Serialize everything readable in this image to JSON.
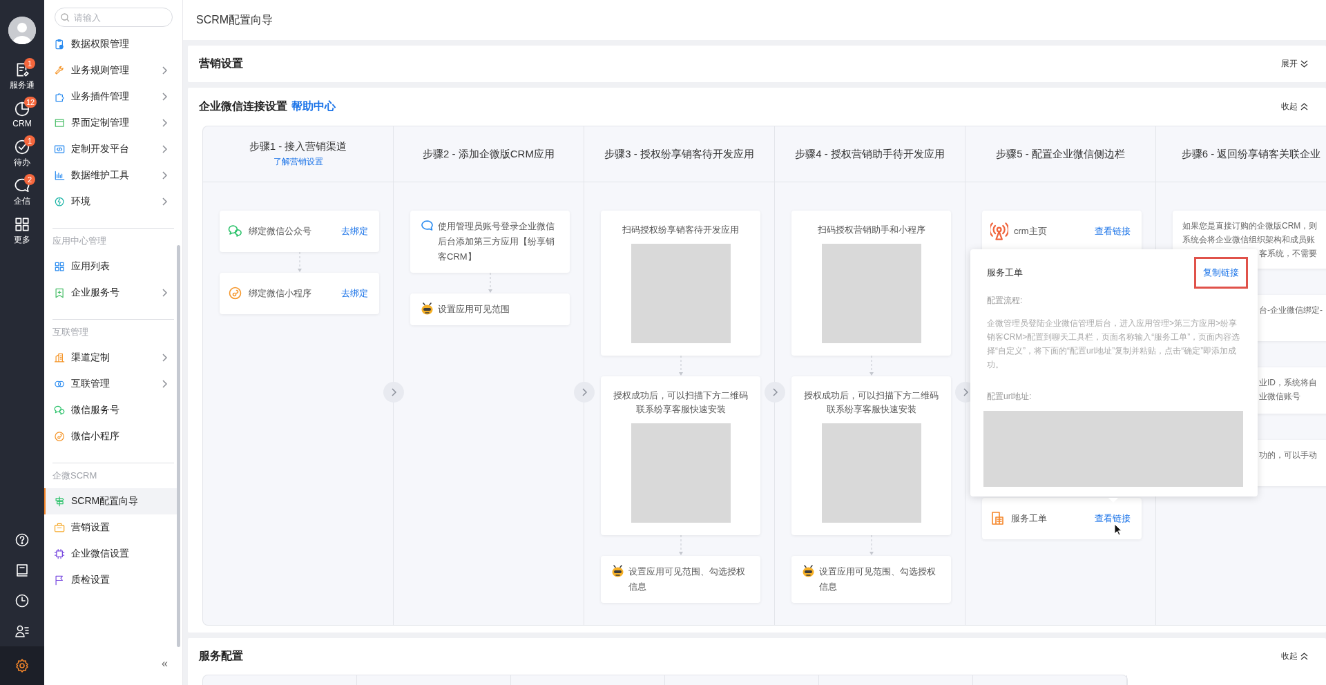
{
  "rail": {
    "items": [
      {
        "label": "服务通",
        "kind": "service",
        "badge": "1"
      },
      {
        "label": "CRM",
        "kind": "crm",
        "badge": "12"
      },
      {
        "label": "待办",
        "kind": "todo",
        "badge": "1"
      },
      {
        "label": "企信",
        "kind": "chat",
        "badge": "2"
      },
      {
        "label": "更多",
        "kind": "more"
      }
    ],
    "bottom_icons": [
      {
        "kind": "help",
        "selected": false
      },
      {
        "kind": "book",
        "selected": false
      },
      {
        "kind": "clock",
        "selected": false
      },
      {
        "kind": "contacts",
        "selected": false
      },
      {
        "kind": "settings",
        "selected": true
      }
    ]
  },
  "sidebar": {
    "search": {
      "placeholder": "请输入"
    },
    "groups": [
      {
        "items": [
          {
            "label": "数据权限管理",
            "kind": "clipboard",
            "has_submenu": false,
            "selected": false
          },
          {
            "label": "业务规则管理",
            "kind": "wrench",
            "has_submenu": true,
            "selected": false
          },
          {
            "label": "业务插件管理",
            "kind": "puzzle",
            "has_submenu": true,
            "selected": false
          },
          {
            "label": "界面定制管理",
            "kind": "window",
            "has_submenu": true,
            "selected": false
          },
          {
            "label": "定制开发平台",
            "kind": "code",
            "has_submenu": true,
            "selected": false
          },
          {
            "label": "数据维护工具",
            "kind": "barchart",
            "has_submenu": true,
            "selected": false
          },
          {
            "label": "环境",
            "kind": "bolt",
            "has_submenu": true,
            "selected": false
          }
        ]
      },
      {
        "title": "应用中心管理",
        "items": [
          {
            "label": "应用列表",
            "kind": "grid",
            "has_submenu": false,
            "selected": false
          },
          {
            "label": "企业服务号",
            "kind": "bookmark",
            "has_submenu": true,
            "selected": false
          }
        ]
      },
      {
        "title": "互联管理",
        "items": [
          {
            "label": "渠道定制",
            "kind": "building",
            "has_submenu": true,
            "selected": false
          },
          {
            "label": "互联管理",
            "kind": "rings",
            "has_submenu": true,
            "selected": false
          },
          {
            "label": "微信服务号",
            "kind": "wechat",
            "has_submenu": false,
            "selected": false
          },
          {
            "label": "微信小程序",
            "kind": "miniapp",
            "has_submenu": false,
            "selected": false
          }
        ]
      },
      {
        "title": "企微SCRM",
        "items": [
          {
            "label": "SCRM配置向导",
            "kind": "signpost",
            "has_submenu": false,
            "selected": true
          },
          {
            "label": "营销设置",
            "kind": "briefcase",
            "has_submenu": false,
            "selected": false
          },
          {
            "label": "企业微信设置",
            "kind": "chip",
            "has_submenu": false,
            "selected": false
          },
          {
            "label": "质检设置",
            "kind": "flag",
            "has_submenu": false,
            "selected": false
          }
        ]
      }
    ],
    "collapse": "«"
  },
  "page_title": "SCRM配置向导",
  "sections": [
    {
      "title": "营销设置",
      "toggle": "展开",
      "expanded": false
    },
    {
      "title": "企业微信连接设置",
      "link": "帮助中心",
      "toggle": "收起",
      "expanded": true,
      "steps": [
        {
          "title": "步骤1 - 接入营销渠道",
          "link": "了解营销设置",
          "connected": true,
          "cards": [
            {
              "kind": "wechat",
              "text": "绑定微信公众号",
              "action": "去绑定"
            },
            {
              "kind": "miniapp",
              "text": "绑定微信小程序",
              "action": "去绑定"
            }
          ]
        },
        {
          "title": "步骤2 - 添加企微版CRM应用",
          "connected": true,
          "cards": [
            {
              "kind": "bubble",
              "text": "使用管理员账号登录企业微信后台添加第三方应用【纷享销客CRM】"
            },
            {
              "kind": "mascot",
              "text": "设置应用可见范围"
            }
          ]
        },
        {
          "title": "步骤3 - 授权纷享销客待开发应用",
          "connected": true,
          "cards": [
            {
              "kind": "qr",
              "text": "扫码授权纷享销客待开发应用"
            },
            {
              "kind": "qr",
              "text": "授权成功后，可以扫描下方二维码联系纷享客服快速安装"
            },
            {
              "kind": "mascot",
              "text": "设置应用可见范围、勾选授权信息"
            }
          ]
        },
        {
          "title": "步骤4 - 授权营销助手待开发应用",
          "connected": true,
          "cards": [
            {
              "kind": "qr",
              "text": "扫码授权营销助手和小程序"
            },
            {
              "kind": "qr",
              "text": "授权成功后，可以扫描下方二维码联系纷享客服快速安装"
            },
            {
              "kind": "mascot",
              "text": "设置应用可见范围、勾选授权信息"
            }
          ]
        },
        {
          "title": "步骤5 - 配置企业微信侧边栏",
          "connected": false,
          "cards": [
            {
              "kind": "antenna",
              "text": "crm主页",
              "action": "查看链接"
            },
            {
              "kind": "form",
              "text": "服务工单",
              "action": "查看链接",
              "popup": {
                "title": "服务工单",
                "action": "复制链接",
                "action_highlighted": true,
                "label_1": "配置流程:",
                "body": "企微管理员登陆企业微信管理后台，进入应用管理>第三方应用>纷享销客CRM>配置到聊天工具栏，页面名称输入“服务工单”，页面内容选择“自定义”，将下面的“配置url地址”复制并粘贴，点击“确定”即添加成功。",
                "label_2": "配置url地址:"
              }
            }
          ]
        },
        {
          "title": "步骤6 - 返回纷享销客关联企业",
          "connected": false,
          "cards": [
            {
              "kind": "note",
              "lines": [
                {
                  "text": "如果您是直接订购的企微版CRM，则",
                  "partly_hidden": false
                },
                {
                  "text": "系统会将企业微信组织架构和成员账",
                  "partly_hidden": false
                },
                {
                  "text": "客系统，不需要",
                  "partly_hidden": true
                }
              ]
            },
            {
              "kind": "note",
              "lines": [
                {
                  "text": "台-企业微信绑定-",
                  "partly_hidden": true
                }
              ]
            },
            {
              "kind": "note",
              "lines": [
                {
                  "text": "业ID，系统将自",
                  "partly_hidden": true
                },
                {
                  "text": "业微信账号",
                  "partly_hidden": true
                }
              ]
            },
            {
              "kind": "note",
              "lines": [
                {
                  "text": "功的，可以手动",
                  "partly_hidden": true
                }
              ]
            }
          ]
        }
      ]
    },
    {
      "title": "服务配置",
      "toggle": "收起",
      "expanded": true
    }
  ]
}
